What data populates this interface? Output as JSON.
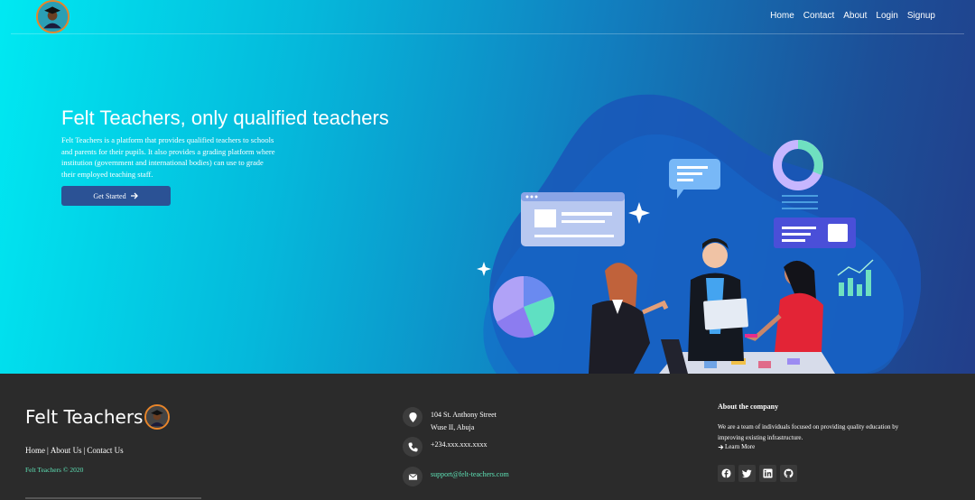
{
  "nav": {
    "links": [
      "Home",
      "Contact",
      "About",
      "Login",
      "Signup"
    ]
  },
  "hero": {
    "title": "Felt Teachers, only qualified teachers",
    "description": "Felt Teachers is a platform that provides qualified teachers to schools and parents for their pupils. It also provides a grading platform where institution (government and international bodies) can use to grade their employed teaching staff.",
    "cta_label": "Get Started"
  },
  "footer": {
    "brand": "Felt Teachers",
    "links": [
      "Home",
      "About Us",
      "Contact Us"
    ],
    "copyright": "Felt Teachers © 2020",
    "address_line1": "104 St. Anthony Street",
    "address_line2": "Wuse II, Abuja",
    "phone": "+234.xxx.xxx.xxxx",
    "email": "support@felt-teachers.com",
    "about_title": "About the company",
    "about_text": "We are a team of individuals focused on providing quality education by improving existing infrastructure.",
    "learn_more": "Learn More",
    "social": [
      "facebook-icon",
      "twitter-icon",
      "linkedin-icon",
      "github-icon"
    ]
  },
  "colors": {
    "accent_green": "#5ee1b5",
    "button_blue": "#2b5295",
    "footer_bg": "#2b2b2b",
    "logo_ring": "#e8852a"
  }
}
